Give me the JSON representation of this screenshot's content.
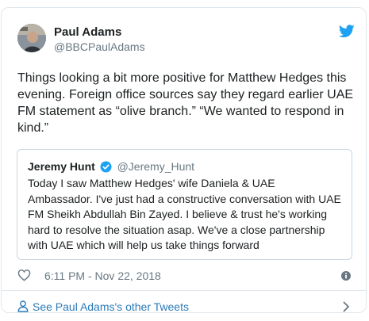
{
  "tweet": {
    "author": {
      "display_name": "Paul Adams",
      "handle": "@BBCPaulAdams"
    },
    "text": "Things looking a bit more positive for Matthew Hedges this evening. Foreign office sources say they regard earlier UAE FM statement as “olive branch.” “We wanted to respond in kind.”",
    "timestamp": "6:11 PM - Nov 22, 2018",
    "icons": {
      "logo": "twitter-bird-icon",
      "like": "heart-icon",
      "info": "info-icon"
    }
  },
  "quoted_tweet": {
    "display_name": "Jeremy Hunt",
    "handle": "@Jeremy_Hunt",
    "verified": true,
    "text": "Today I saw Matthew Hedges' wife Daniela & UAE Ambassador. I've just had a constructive conversation with UAE FM Sheikh Abdullah Bin Zayed. I believe & trust he's working hard to resolve the situation asap. We've a close partnership with UAE which will help us take things forward"
  },
  "footer": {
    "link_text": "See Paul Adams's other Tweets",
    "icons": {
      "person": "person-icon",
      "chevron": "chevron-right-icon"
    }
  },
  "colors": {
    "twitter_blue": "#1da1f2",
    "link_blue": "#2b7bb9",
    "text": "#1c2022",
    "muted": "#697882",
    "border": "#e1e8ed"
  }
}
